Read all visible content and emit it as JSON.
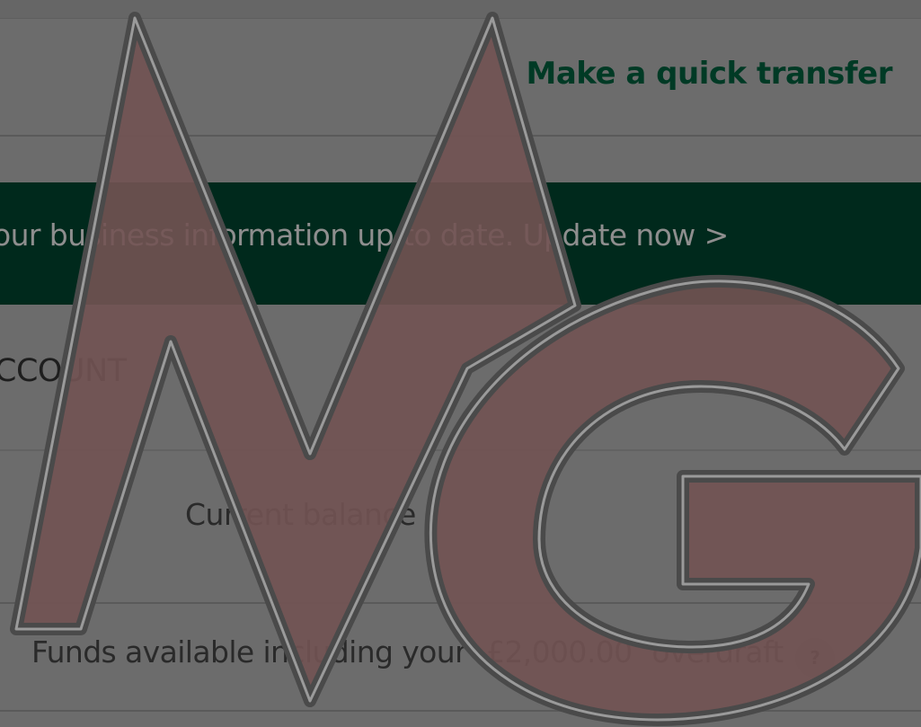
{
  "header": {
    "quick_transfer_label": "Make a quick transfer"
  },
  "banner": {
    "message": "our business information up to date.",
    "link_label": "Update now >"
  },
  "account": {
    "heading": "CCOUNT",
    "current_balance_label": "Current balance",
    "funds": {
      "prefix": "Funds available including your",
      "overdraft_amount": "£2,000.00",
      "suffix": "overdraft"
    },
    "help_label": "?"
  },
  "watermark": {
    "text": "MG",
    "icon": "mg-logo-watermark",
    "fill_color": "#725353",
    "stroke_color": "#4a4a4a"
  },
  "colors": {
    "brand_green": "#003a25",
    "banner_bg": "#00291c",
    "overlay_bg": "#6c6c6c"
  }
}
